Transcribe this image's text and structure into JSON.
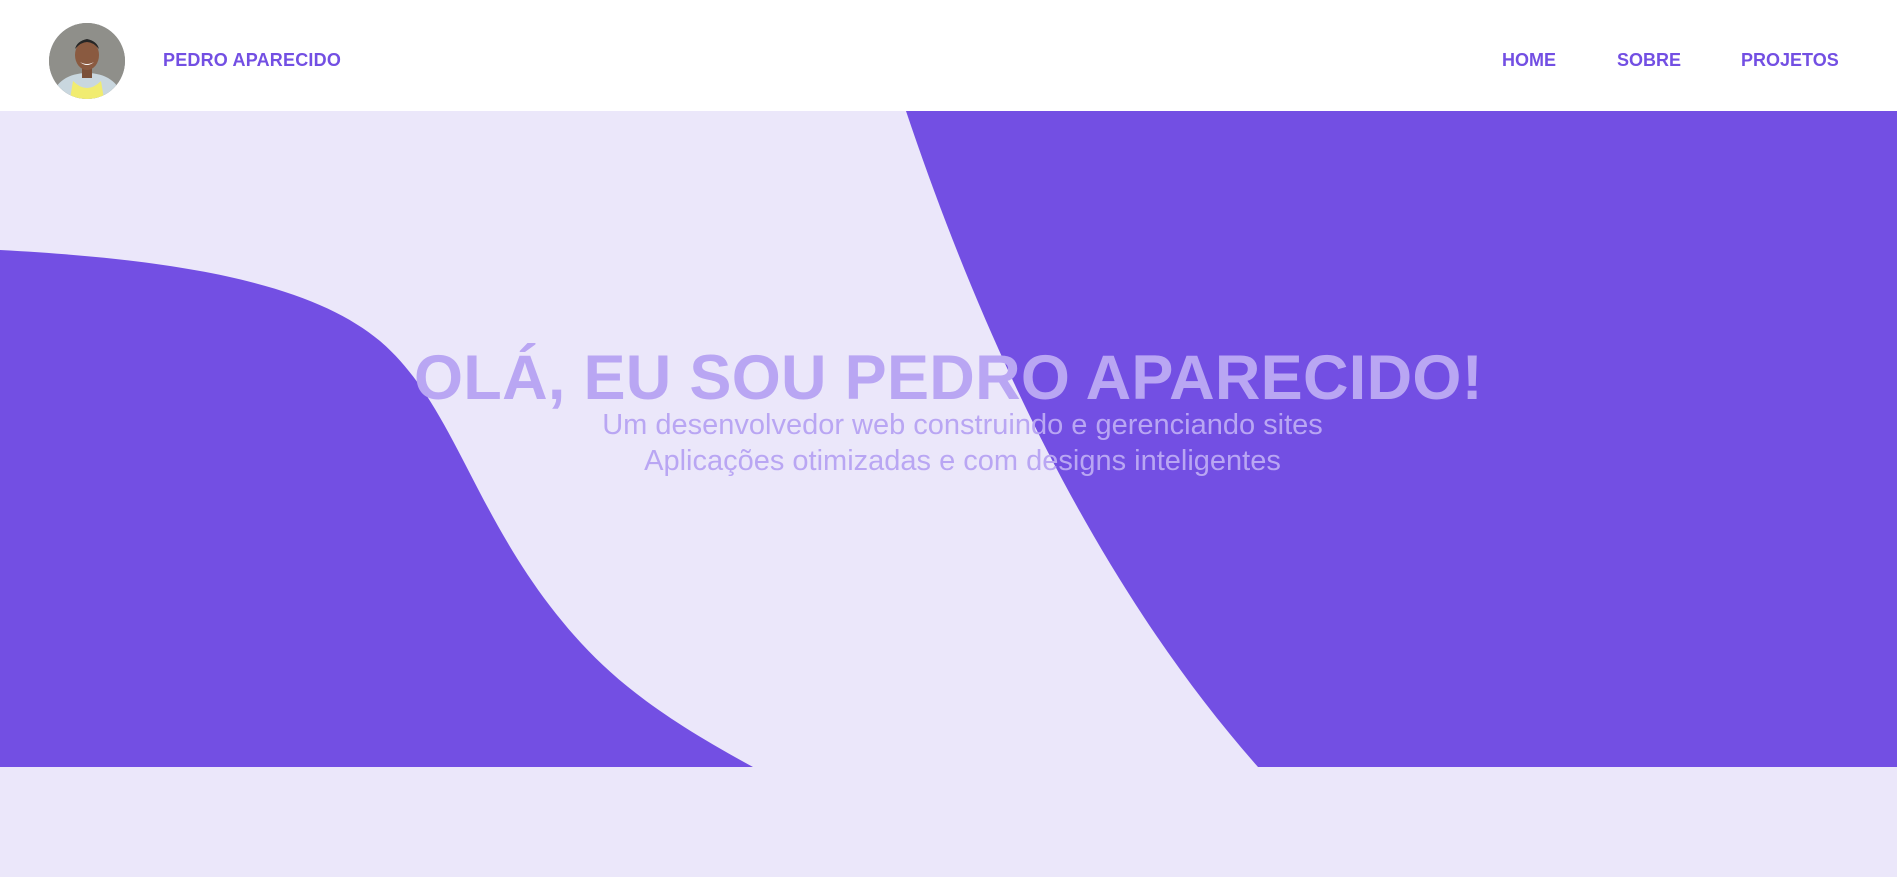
{
  "header": {
    "brand_name": "PEDRO APARECIDO",
    "avatar_icon": "profile-photo",
    "nav": {
      "home": "HOME",
      "sobre": "SOBRE",
      "projetos": "PROJETOS"
    }
  },
  "hero": {
    "title": "OLÁ, EU SOU PEDRO APARECIDO!",
    "subtitle_line1": "Um desenvolvedor web construindo e gerenciando sites",
    "subtitle_line2": "Aplicações otimizadas e com designs inteligentes"
  },
  "colors": {
    "accent": "#734fe3",
    "hero_background": "#ebe7fa",
    "hero_text": "#b9a6f3",
    "header_background": "#ffffff"
  }
}
